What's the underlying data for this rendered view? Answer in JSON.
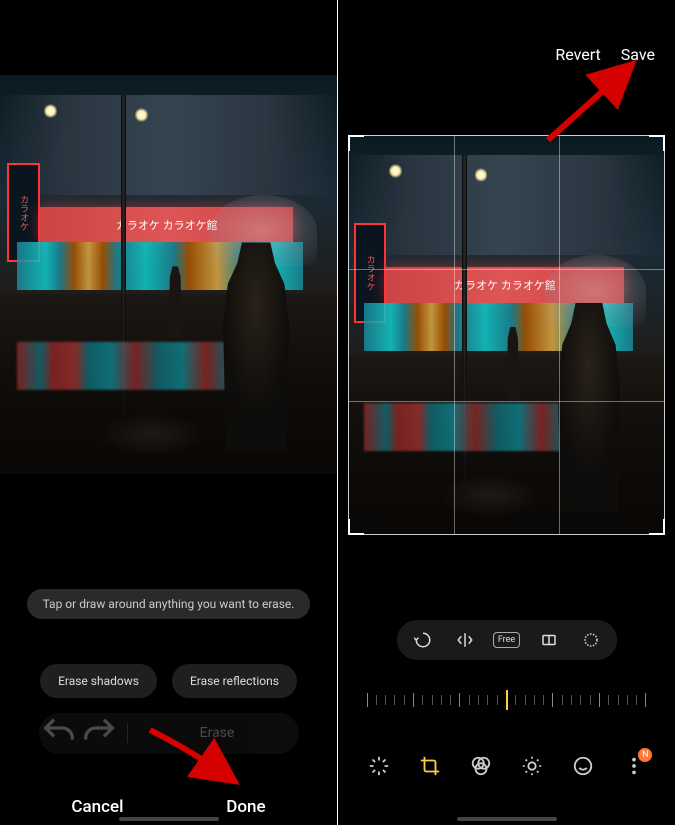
{
  "left_screen": {
    "hint_text": "Tap or draw around anything you want to erase.",
    "erase_shadows_label": "Erase shadows",
    "erase_reflections_label": "Erase reflections",
    "erase_label": "Erase",
    "cancel_label": "Cancel",
    "done_label": "Done",
    "photo_scene": {
      "left_sign": "カラオケ",
      "banner": "カラオケ カラオケ館"
    }
  },
  "right_screen": {
    "revert_label": "Revert",
    "save_label": "Save",
    "free_ratio_label": "Free",
    "badge_label": "N",
    "photo_scene": {
      "left_sign": "カラオケ",
      "banner": "カラオケ カラオケ館"
    }
  },
  "colors": {
    "accent": "#ffcc44",
    "badge": "#ff7733",
    "arrow": "#d50000"
  }
}
